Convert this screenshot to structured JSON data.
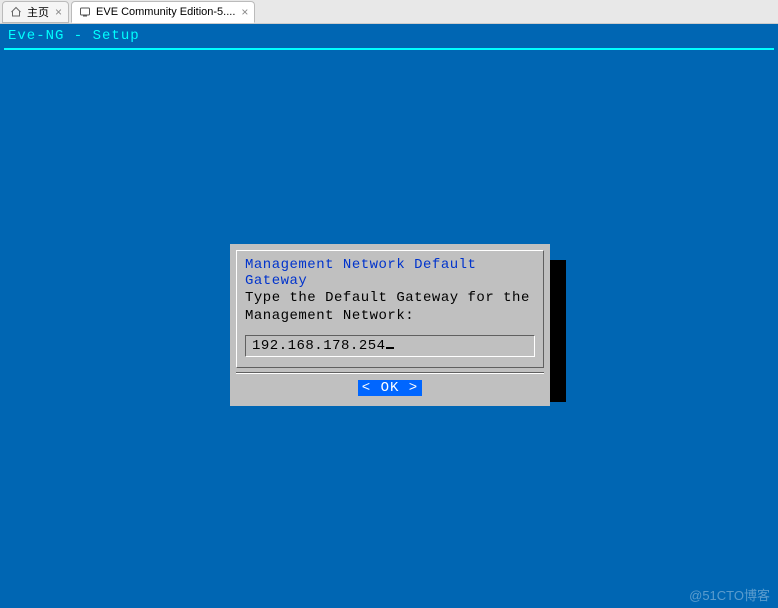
{
  "tabs": {
    "home": {
      "label": "主页"
    },
    "eve": {
      "label": "EVE Community Edition-5...."
    }
  },
  "terminal": {
    "title": "Eve-NG - Setup"
  },
  "dialog": {
    "title": "Management Network Default Gateway",
    "text_line1": "Type the Default Gateway for the",
    "text_line2": "Management Network:",
    "input_value": "192.168.178.254",
    "ok_label": "<  OK  >"
  },
  "watermark": "@51CTO博客"
}
